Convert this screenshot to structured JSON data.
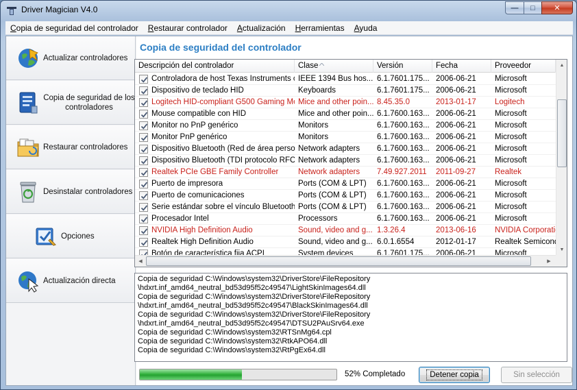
{
  "window": {
    "title": "Driver Magician V4.0"
  },
  "menu": [
    {
      "label": "Copia de seguridad del controlador",
      "mnemonic_index": 0
    },
    {
      "label": "Restaurar controlador",
      "mnemonic_index": 0
    },
    {
      "label": "Actualización",
      "mnemonic_index": 0
    },
    {
      "label": "Herramientas",
      "mnemonic_index": 0
    },
    {
      "label": "Ayuda",
      "mnemonic_index": 0
    }
  ],
  "sidebar": {
    "items": [
      {
        "label": "Actualizar controladores",
        "icon": "globe-update-icon"
      },
      {
        "label": "Copia de seguridad de los controladores",
        "icon": "backup-document-icon"
      },
      {
        "label": "Restaurar controladores",
        "icon": "restore-folder-icon"
      },
      {
        "label": "Desinstalar controladores",
        "icon": "recycle-bin-icon"
      },
      {
        "label": "Opciones",
        "icon": "options-check-icon"
      },
      {
        "label": "Actualización directa",
        "icon": "globe-cursor-icon"
      }
    ]
  },
  "main": {
    "title": "Copia de seguridad del controlador",
    "table": {
      "columns": [
        "Descripción del controlador",
        "Clase",
        "Versión",
        "Fecha",
        "Proveedor"
      ],
      "sorted_column": "Clase",
      "rows": [
        {
          "checked": true,
          "red": false,
          "desc": "Controladora de host Texas Instruments c...",
          "clase": "IEEE 1394 Bus hos...",
          "version": "6.1.7601.175...",
          "fecha": "2006-06-21",
          "proveedor": "Microsoft"
        },
        {
          "checked": true,
          "red": false,
          "desc": "Dispositivo de teclado HID",
          "clase": "Keyboards",
          "version": "6.1.7601.175...",
          "fecha": "2006-06-21",
          "proveedor": "Microsoft"
        },
        {
          "checked": true,
          "red": true,
          "desc": "Logitech HID-compliant G500 Gaming Mo...",
          "clase": "Mice and other poin...",
          "version": "8.45.35.0",
          "fecha": "2013-01-17",
          "proveedor": "Logitech"
        },
        {
          "checked": true,
          "red": false,
          "desc": "Mouse compatible con HID",
          "clase": "Mice and other poin...",
          "version": "6.1.7600.163...",
          "fecha": "2006-06-21",
          "proveedor": "Microsoft"
        },
        {
          "checked": true,
          "red": false,
          "desc": "Monitor no PnP genérico",
          "clase": "Monitors",
          "version": "6.1.7600.163...",
          "fecha": "2006-06-21",
          "proveedor": "Microsoft"
        },
        {
          "checked": true,
          "red": false,
          "desc": "Monitor PnP genérico",
          "clase": "Monitors",
          "version": "6.1.7600.163...",
          "fecha": "2006-06-21",
          "proveedor": "Microsoft"
        },
        {
          "checked": true,
          "red": false,
          "desc": "Dispositivo Bluetooth (Red de área perso...",
          "clase": "Network adapters",
          "version": "6.1.7600.163...",
          "fecha": "2006-06-21",
          "proveedor": "Microsoft"
        },
        {
          "checked": true,
          "red": false,
          "desc": "Dispositivo Bluetooth (TDI protocolo RFC...",
          "clase": "Network adapters",
          "version": "6.1.7600.163...",
          "fecha": "2006-06-21",
          "proveedor": "Microsoft"
        },
        {
          "checked": true,
          "red": true,
          "desc": "Realtek PCIe GBE Family Controller",
          "clase": "Network adapters",
          "version": "7.49.927.2011",
          "fecha": "2011-09-27",
          "proveedor": "Realtek"
        },
        {
          "checked": true,
          "red": false,
          "desc": "Puerto de impresora",
          "clase": "Ports (COM & LPT)",
          "version": "6.1.7600.163...",
          "fecha": "2006-06-21",
          "proveedor": "Microsoft"
        },
        {
          "checked": true,
          "red": false,
          "desc": "Puerto de comunicaciones",
          "clase": "Ports (COM & LPT)",
          "version": "6.1.7600.163...",
          "fecha": "2006-06-21",
          "proveedor": "Microsoft"
        },
        {
          "checked": true,
          "red": false,
          "desc": "Serie estándar sobre el vínculo Bluetooth",
          "clase": "Ports (COM & LPT)",
          "version": "6.1.7600.163...",
          "fecha": "2006-06-21",
          "proveedor": "Microsoft"
        },
        {
          "checked": true,
          "red": false,
          "desc": "Procesador Intel",
          "clase": "Processors",
          "version": "6.1.7600.163...",
          "fecha": "2006-06-21",
          "proveedor": "Microsoft"
        },
        {
          "checked": true,
          "red": true,
          "desc": "NVIDIA High Definition Audio",
          "clase": "Sound, video and g...",
          "version": "1.3.26.4",
          "fecha": "2013-06-16",
          "proveedor": "NVIDIA Corporation"
        },
        {
          "checked": true,
          "red": false,
          "desc": "Realtek High Definition Audio",
          "clase": "Sound, video and g...",
          "version": "6.0.1.6554",
          "fecha": "2012-01-17",
          "proveedor": "Realtek Semiconductor"
        },
        {
          "checked": true,
          "red": false,
          "desc": "Botón de característica fija ACPI",
          "clase": "System devices",
          "version": "6.1.7601.175...",
          "fecha": "2006-06-21",
          "proveedor": "Microsoft"
        }
      ]
    },
    "log_lines": [
      "Copia de seguridad C:\\Windows\\system32\\DriverStore\\FileRepository",
      "\\hdxrt.inf_amd64_neutral_bd53d95f52c49547\\LightSkinImages64.dll",
      "Copia de seguridad C:\\Windows\\system32\\DriverStore\\FileRepository",
      "\\hdxrt.inf_amd64_neutral_bd53d95f52c49547\\BlackSkinImages64.dll",
      "Copia de seguridad C:\\Windows\\system32\\DriverStore\\FileRepository",
      "\\hdxrt.inf_amd64_neutral_bd53d95f52c49547\\DTSU2PAuSrv64.exe",
      "Copia de seguridad C:\\Windows\\system32\\RTSnMg64.cpl",
      "Copia de seguridad C:\\Windows\\system32\\RtkAPO64.dll",
      "Copia de seguridad C:\\Windows\\system32\\RtPgEx64.dll"
    ],
    "progress": {
      "percent": 52,
      "label": "52% Completado"
    },
    "buttons": {
      "stop": "Detener copia",
      "no_selection": "Sin selección"
    }
  },
  "colors": {
    "title_accent": "#2d7fc4",
    "highlight_red": "#c8211b",
    "progress_green": "#35b33f"
  }
}
